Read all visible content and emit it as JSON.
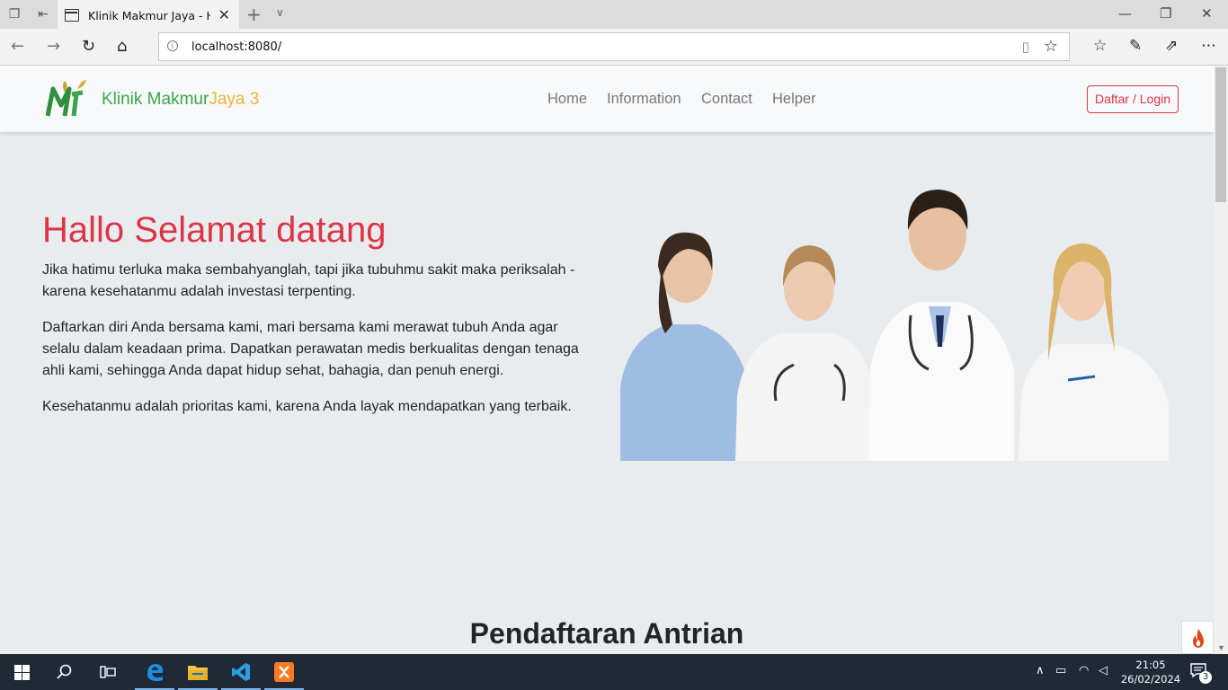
{
  "browser": {
    "tab_title": "Klinik Makmur Jaya - Ho",
    "url": "localhost:8080/"
  },
  "site": {
    "brand_primary": "Klinik Makmur",
    "brand_secondary": "Jaya 3",
    "nav": [
      "Home",
      "Information",
      "Contact",
      "Helper"
    ],
    "login_button": "Daftar / Login"
  },
  "hero": {
    "title": "Hallo Selamat datang",
    "paragraphs": [
      "Jika hatimu terluka maka sembahyanglah, tapi jika tubuhmu sakit maka periksalah - karena kesehatanmu adalah investasi terpenting.",
      "Daftarkan diri Anda bersama kami, mari bersama kami merawat tubuh Anda agar selalu dalam keadaan prima. Dapatkan perawatan medis berkualitas dengan tenaga ahli kami, sehingga Anda dapat hidup sehat, bahagia, dan penuh energi.",
      "Kesehatanmu adalah prioritas kami, karena Anda layak mendapatkan yang terbaik."
    ]
  },
  "section": {
    "title": "Pendaftaran Antrian"
  },
  "taskbar": {
    "time": "21:05",
    "date": "26/02/2024",
    "notification_count": "3"
  },
  "colors": {
    "accent": "#dc3545",
    "brand_green": "#3aa54a",
    "brand_yellow": "#f0b43a",
    "page_bg": "#e9ecef"
  }
}
